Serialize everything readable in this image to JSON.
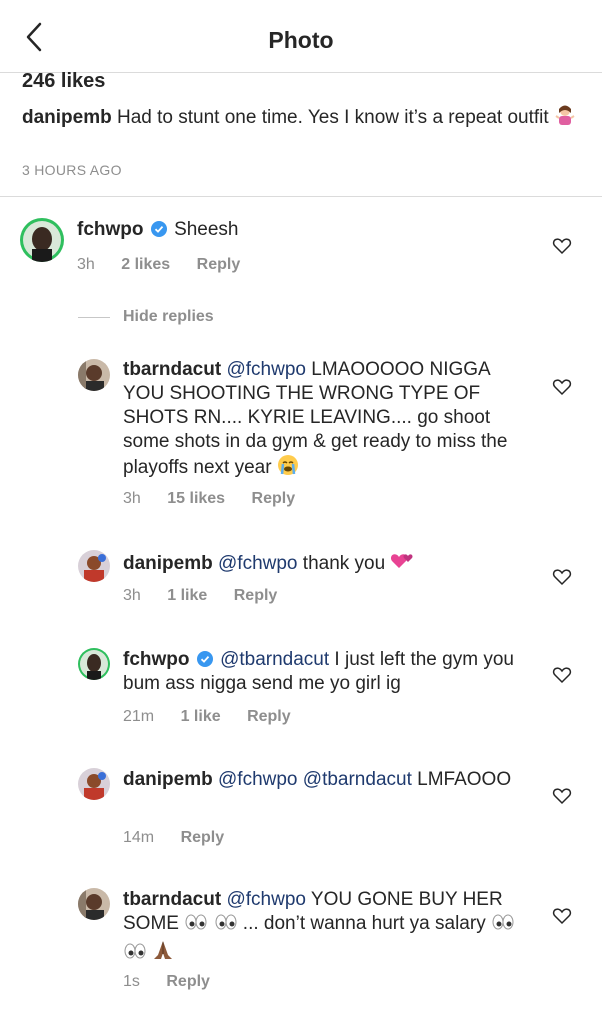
{
  "header": {
    "title": "Photo"
  },
  "post": {
    "likes": "246 likes",
    "caption_user": "danipemb",
    "caption_text": "Had to stunt one time. Yes I know it’s a repeat outfit",
    "time_ago": "3 HOURS AGO"
  },
  "comment": {
    "user": "fchwpo",
    "text": "Sheesh",
    "time": "3h",
    "likes": "2 likes",
    "reply": "Reply"
  },
  "hide_replies": "Hide replies",
  "replies": [
    {
      "user": "tbarndacut",
      "mention": "@fchwpo",
      "text": "LMAOOOOO NIGGA YOU SHOOTING THE WRONG TYPE OF SHOTS RN.... KYRIE LEAVING.... go shoot some shots in da gym & get ready to miss the playoffs next year",
      "time": "3h",
      "likes": "15 likes",
      "reply": "Reply"
    },
    {
      "user": "danipemb",
      "mention": "@fchwpo",
      "text": "thank you",
      "time": "3h",
      "likes": "1 like",
      "reply": "Reply"
    },
    {
      "user": "fchwpo",
      "mention": "@tbarndacut",
      "text": "I just left the gym you bum ass nigga send me yo girl ig",
      "time": "21m",
      "likes": "1 like",
      "reply": "Reply"
    },
    {
      "user": "danipemb",
      "mention": "@fchwpo @tbarndacut",
      "text": "LMFAOOO",
      "time": "14m",
      "likes": "",
      "reply": "Reply"
    },
    {
      "user": "tbarndacut",
      "mention": "@fchwpo",
      "text": "YOU GONE BUY HER SOME",
      "text2": "... don’t wanna hurt ya salary",
      "time": "1s",
      "likes": "",
      "reply": "Reply"
    }
  ]
}
